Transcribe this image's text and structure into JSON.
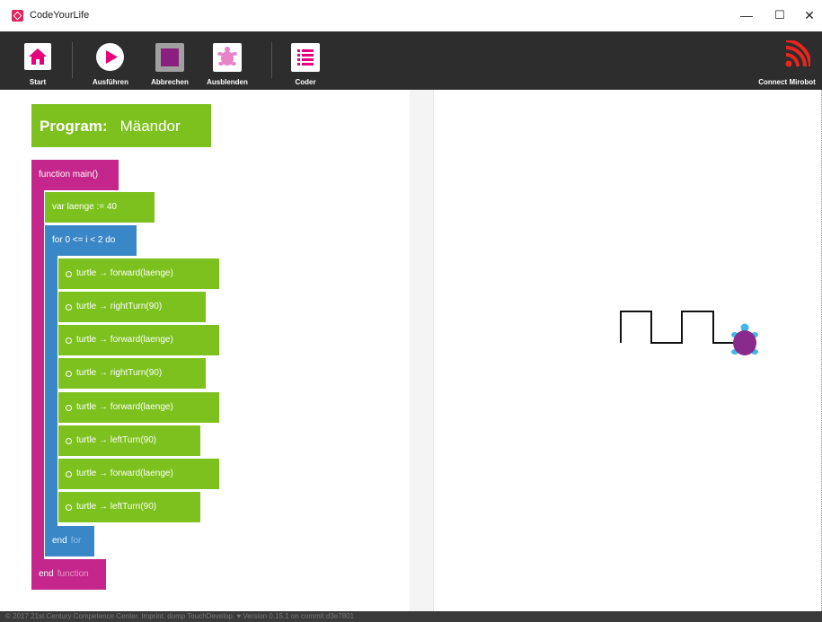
{
  "window": {
    "title": "CodeYourLife",
    "minimize": "—",
    "maximize": "☐",
    "close": "✕"
  },
  "toolbar": {
    "start": "Start",
    "run": "Ausführen",
    "cancel": "Abbrechen",
    "hide": "Ausblenden",
    "coder": "Coder",
    "connect": "Connect Mirobot"
  },
  "colors": {
    "accent": "#e6007e",
    "green": "#7cc11d",
    "magenta": "#c4268b",
    "blue": "#3a87c8",
    "turtle_body": "#8a2a8c",
    "turtle_limbs": "#40b8e8"
  },
  "program": {
    "label": "Program:",
    "name": "Mäandor",
    "function_header": "function main()",
    "var_decl": "var laenge := 40",
    "for_header": "for 0 <= i < 2 do",
    "statements": [
      "turtle → forward(laenge)",
      "turtle → rightTurn(90)",
      "turtle → forward(laenge)",
      "turtle → rightTurn(90)",
      "turtle → forward(laenge)",
      "turtle → leftTurn(90)",
      "turtle → forward(laenge)",
      "turtle → leftTurn(90)"
    ],
    "end_for_kw": "end",
    "end_for_word": "for",
    "end_function_kw": "end",
    "end_function_word": "function"
  },
  "footer": {
    "text": "© 2017 21st Century Competence Center. Imprint. dump TouchDevelop. ♥ Version 0.15.1 on commit d3e7801"
  },
  "icons": {
    "start": "home-icon",
    "run": "play-icon",
    "cancel": "stop-icon",
    "hide": "turtle-icon",
    "coder": "list-icon",
    "connect": "wifi-signal-icon"
  }
}
